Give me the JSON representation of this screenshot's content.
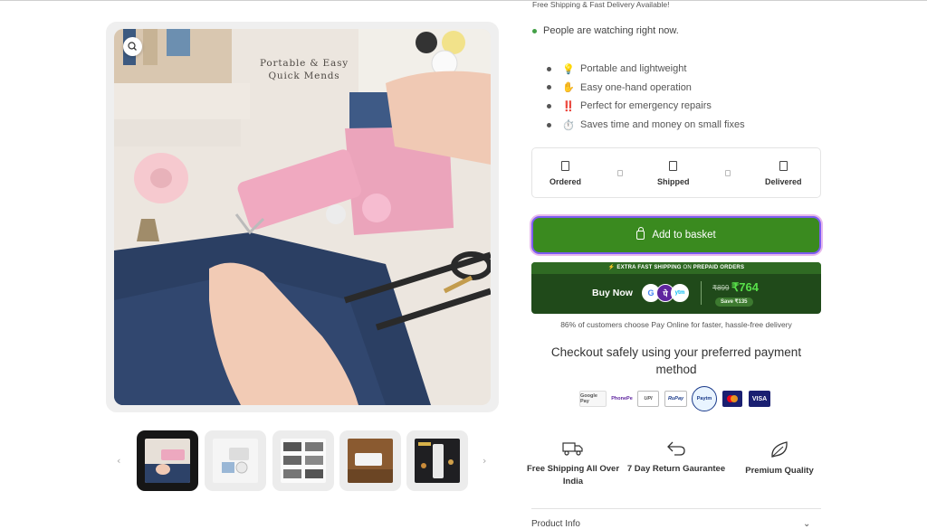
{
  "top_notice": "Free Shipping & Fast Delivery Available!",
  "watching": "People are watching right now.",
  "features": [
    {
      "icon": "💡",
      "text": "Portable and lightweight"
    },
    {
      "icon": "✋",
      "text": "Easy one-hand operation"
    },
    {
      "icon": "‼️",
      "text": "Perfect for emergency repairs"
    },
    {
      "icon": "⏱️",
      "text": "Saves time and money on small fixes"
    }
  ],
  "tracker": {
    "steps": [
      "Ordered",
      "Shipped",
      "Delivered"
    ]
  },
  "add_to_basket": "Add to basket",
  "buy_now": {
    "banner_prefix": "⚡ EXTRA FAST ",
    "banner_mid": "SHIPPING",
    "banner_on": " ON ",
    "banner_suffix": "PREPAID ORDERS",
    "label": "Buy Now",
    "old_price": "₹899",
    "new_price": "₹764",
    "save": "Save ₹135"
  },
  "pay_note": "86% of customers choose Pay Online for faster, hassle-free delivery",
  "checkout_heading": "Checkout safely using your preferred payment method",
  "payment_methods": [
    "Google Pay",
    "PhonePe",
    "UPI",
    "RuPay",
    "Paytm",
    "Mastercard",
    "VISA"
  ],
  "image_caption": {
    "line1": "Portable & Easy",
    "line2": "Quick Mends"
  },
  "trust_badges": [
    {
      "icon": "truck-icon",
      "text": "Free Shipping All Over India"
    },
    {
      "icon": "return-icon",
      "text": "7 Day Return Gaurantee"
    },
    {
      "icon": "leaf-icon",
      "text": "Premium Quality"
    }
  ],
  "product_info": "Product Info",
  "thumb_arrows": {
    "prev": "‹",
    "next": "›"
  },
  "colors": {
    "basket": "#3a8a1f",
    "basket_border": "#7b5cf0",
    "buy_now_bg": "#204a1a",
    "price_green": "#58e04a"
  }
}
